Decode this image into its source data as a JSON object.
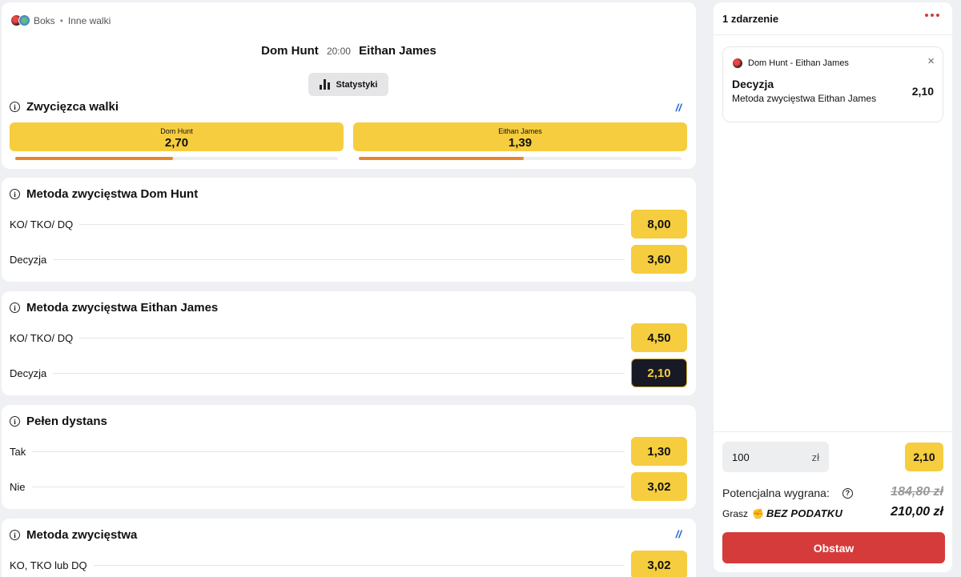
{
  "header": {
    "sport": "Boks",
    "category": "Inne walki",
    "home": "Dom Hunt",
    "time": "20:00",
    "away": "Eithan James",
    "stats_label": "Statystyki"
  },
  "winner_market": {
    "title": "Zwycięzca walki",
    "options": [
      {
        "name": "Dom Hunt",
        "odd": "2,70",
        "percent": 49
      },
      {
        "name": "Eithan James",
        "odd": "1,39",
        "percent": 51
      }
    ]
  },
  "markets": [
    {
      "title": "Metoda zwycięstwa Dom Hunt",
      "rows": [
        {
          "label": "KO/ TKO/ DQ",
          "odd": "8,00"
        },
        {
          "label": "Decyzja",
          "odd": "3,60"
        }
      ]
    },
    {
      "title": "Metoda zwycięstwa Eithan James",
      "rows": [
        {
          "label": "KO/ TKO/ DQ",
          "odd": "4,50"
        },
        {
          "label": "Decyzja",
          "odd": "2,10",
          "selected": true
        }
      ]
    },
    {
      "title": "Pełen dystans",
      "rows": [
        {
          "label": "Tak",
          "odd": "1,30"
        },
        {
          "label": "Nie",
          "odd": "3,02"
        }
      ]
    },
    {
      "title": "Metoda zwycięstwa",
      "rows": [
        {
          "label": "KO, TKO lub DQ",
          "odd": "3,02"
        }
      ]
    }
  ],
  "betslip": {
    "title": "1 zdarzenie",
    "selection": {
      "event": "Dom Hunt - Eithan James",
      "market": "Decyzja",
      "pick": "Metoda zwycięstwa Eithan James",
      "odd": "2,10"
    },
    "stake": "100",
    "currency": "zł",
    "total_odd": "2,10",
    "potential_label": "Potencjalna wygrana:",
    "potential_old": "184,80 zł",
    "play_label": "Grasz",
    "tax_free_label": "BEZ PODATKU",
    "potential_new": "210,00 zł",
    "place_label": "Obstaw"
  },
  "colors": {
    "odd_button": "#f5cd3f",
    "selected_odd": "#171a24",
    "place_button": "#d63b3b",
    "progress": "#e9862d"
  }
}
